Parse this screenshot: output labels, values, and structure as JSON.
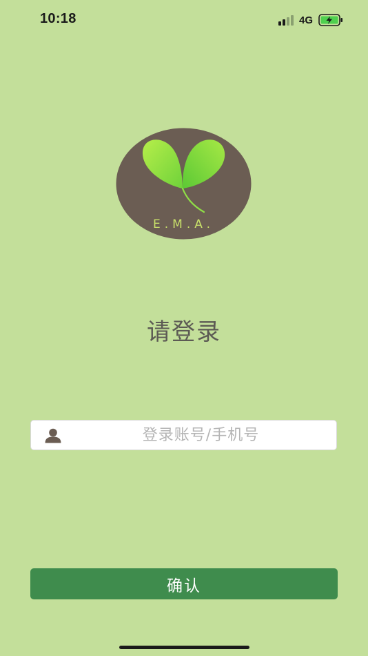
{
  "status_bar": {
    "time": "10:18",
    "network": "4G",
    "signal_icon": "signal-bars-icon",
    "battery_icon": "battery-charging-icon"
  },
  "logo": {
    "icon": "leaf-heart-logo",
    "text": "E.M.A.",
    "colors": {
      "background": "#6b5d53",
      "leaf": "#8fe046",
      "text": "#c8e06a"
    }
  },
  "login": {
    "title": "请登录",
    "account_placeholder": "登录账号/手机号",
    "account_value": "",
    "user_icon": "user-icon",
    "confirm_label": "确认"
  },
  "colors": {
    "page_background": "#c3df9a",
    "button_background": "#3f8c4d",
    "title_text": "#5c5a54"
  }
}
